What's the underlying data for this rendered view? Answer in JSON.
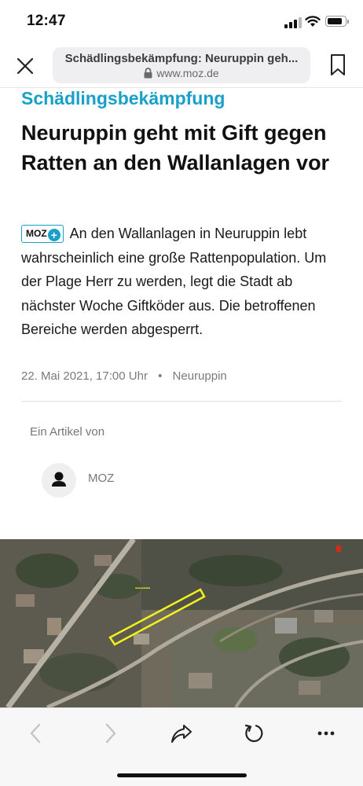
{
  "status_bar": {
    "time": "12:47",
    "signal_icon": "cellular-signal-icon",
    "wifi_icon": "wifi-icon",
    "battery_icon": "battery-icon",
    "battery_level": 0.85
  },
  "browser": {
    "close_icon": "close-icon",
    "page_title": "Schädlingsbekämpfung: Neuruppin geh...",
    "domain": "www.moz.de",
    "lock_icon": "lock-icon",
    "bookmark_icon": "bookmark-icon"
  },
  "article": {
    "kicker": "Schädlingsbekämpfung",
    "headline": "Neuruppin geht mit Gift gegen Ratten an den Wallanlagen vor",
    "badge": "MOZ",
    "badge_plus": "+",
    "lead": "An den Wallanlagen in Neuruppin lebt wahrscheinlich eine große Rattenpopulation. Um der Plage Herr zu werden, legt die Stadt ab nächster Woche Giftköder aus. Die betroffenen Bereiche werden abgesperrt.",
    "date": "22. Mai 2021, 17:00 Uhr",
    "separator": "•",
    "location": "Neuruppin",
    "by_label": "Ein Artikel von",
    "author": "MOZ",
    "avatar_icon": "person-icon"
  },
  "map": {
    "highlight_color": "#f2f21a",
    "marker_color": "#d42a1e"
  },
  "toolbar": {
    "back_icon": "chevron-left-icon",
    "forward_icon": "chevron-right-icon",
    "share_icon": "share-arrow-icon",
    "reload_icon": "reload-icon",
    "more_icon": "more-dots-icon"
  }
}
